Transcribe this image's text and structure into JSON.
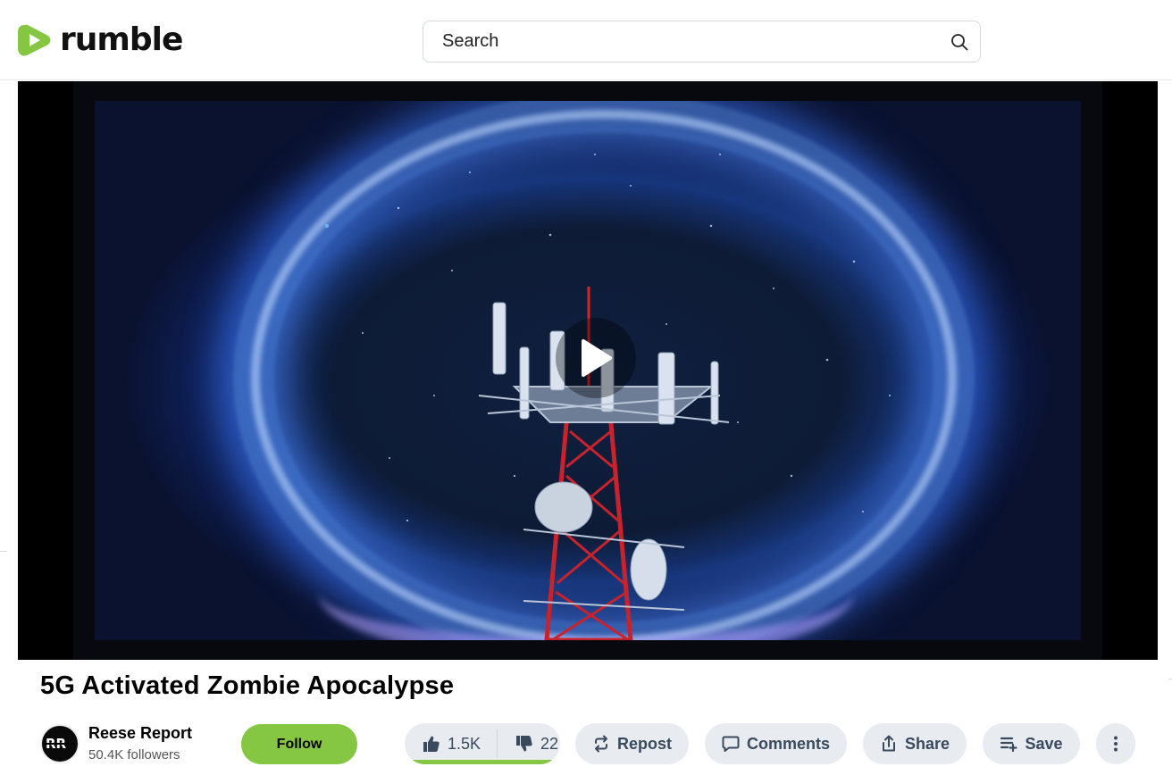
{
  "header": {
    "logo_text": "rumble",
    "search_placeholder": "Search"
  },
  "video": {
    "title": "5G Activated Zombie Apocalypse"
  },
  "channel": {
    "name": "Reese Report",
    "followers": "50.4K followers",
    "follow_label": "Follow"
  },
  "actions": {
    "likes": "1.5K",
    "dislikes": "22",
    "like_ratio": 0.985,
    "repost_label": "Repost",
    "comments_label": "Comments",
    "share_label": "Share",
    "save_label": "Save"
  },
  "colors": {
    "brand_green": "#85c742",
    "pill_bg": "#e8ecf0",
    "pill_text": "#3a4a5e"
  },
  "icons": [
    "rumble-logo-icon",
    "search-icon",
    "play-icon",
    "thumbs-up-icon",
    "thumbs-down-icon",
    "repost-icon",
    "comment-icon",
    "share-icon",
    "save-playlist-icon",
    "more-vertical-icon"
  ]
}
